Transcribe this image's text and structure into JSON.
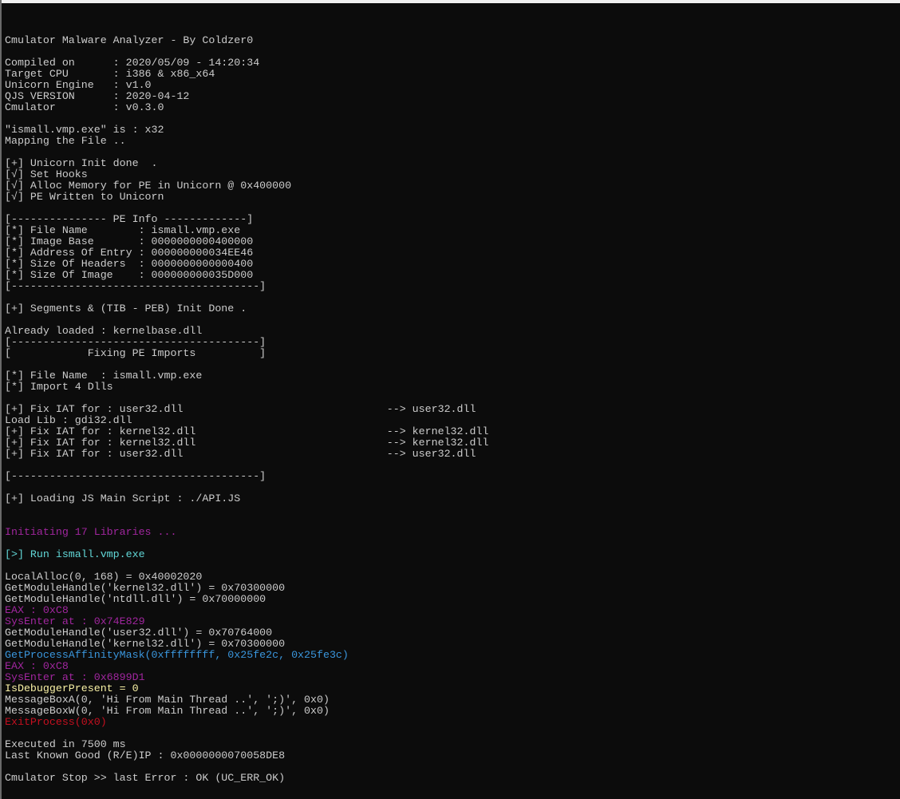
{
  "lines": [
    {
      "text": "",
      "color": "default"
    },
    {
      "text": "Cmulator Malware Analyzer - By Coldzer0",
      "color": "default"
    },
    {
      "text": "",
      "color": "default"
    },
    {
      "text": "Compiled on      : 2020/05/09 - 14:20:34",
      "color": "default"
    },
    {
      "text": "Target CPU       : i386 & x86_x64",
      "color": "default"
    },
    {
      "text": "Unicorn Engine   : v1.0",
      "color": "default"
    },
    {
      "text": "QJS VERSION      : 2020-04-12",
      "color": "default"
    },
    {
      "text": "Cmulator         : v0.3.0",
      "color": "default"
    },
    {
      "text": "",
      "color": "default"
    },
    {
      "text": "\"ismall.vmp.exe\" is : x32",
      "color": "default"
    },
    {
      "text": "Mapping the File ..",
      "color": "default"
    },
    {
      "text": "",
      "color": "default"
    },
    {
      "text": "[+] Unicorn Init done  .",
      "color": "default"
    },
    {
      "text": "[√] Set Hooks",
      "color": "default"
    },
    {
      "text": "[√] Alloc Memory for PE in Unicorn @ 0x400000",
      "color": "default"
    },
    {
      "text": "[√] PE Written to Unicorn",
      "color": "default"
    },
    {
      "text": "",
      "color": "default"
    },
    {
      "text": "[--------------- PE Info -------------]",
      "color": "default"
    },
    {
      "text": "[*] File Name        : ismall.vmp.exe",
      "color": "default"
    },
    {
      "text": "[*] Image Base       : 0000000000400000",
      "color": "default"
    },
    {
      "text": "[*] Address Of Entry : 000000000034EE46",
      "color": "default"
    },
    {
      "text": "[*] Size Of Headers  : 0000000000000400",
      "color": "default"
    },
    {
      "text": "[*] Size Of Image    : 000000000035D000",
      "color": "default"
    },
    {
      "text": "[---------------------------------------]",
      "color": "default"
    },
    {
      "text": "",
      "color": "default"
    },
    {
      "text": "[+] Segments & (TIB - PEB) Init Done .",
      "color": "default"
    },
    {
      "text": "",
      "color": "default"
    },
    {
      "text": "Already loaded : kernelbase.dll",
      "color": "default"
    },
    {
      "text": "[---------------------------------------]",
      "color": "default"
    },
    {
      "text": "[            Fixing PE Imports          ]",
      "color": "default"
    },
    {
      "text": "",
      "color": "default"
    },
    {
      "text": "[*] File Name  : ismall.vmp.exe",
      "color": "default"
    },
    {
      "text": "[*] Import 4 Dlls",
      "color": "default"
    },
    {
      "text": "",
      "color": "default"
    },
    {
      "text": "[+] Fix IAT for : user32.dll                                --> user32.dll",
      "color": "default"
    },
    {
      "text": "Load Lib : gdi32.dll",
      "color": "default"
    },
    {
      "text": "[+] Fix IAT for : kernel32.dll                              --> kernel32.dll",
      "color": "default"
    },
    {
      "text": "[+] Fix IAT for : kernel32.dll                              --> kernel32.dll",
      "color": "default"
    },
    {
      "text": "[+] Fix IAT for : user32.dll                                --> user32.dll",
      "color": "default"
    },
    {
      "text": "",
      "color": "default"
    },
    {
      "text": "[---------------------------------------]",
      "color": "default"
    },
    {
      "text": "",
      "color": "default"
    },
    {
      "text": "[+] Loading JS Main Script : ./API.JS",
      "color": "default"
    },
    {
      "text": "",
      "color": "default"
    },
    {
      "text": "",
      "color": "default"
    },
    {
      "text": "Initiating 17 Libraries ...",
      "color": "magenta"
    },
    {
      "text": "",
      "color": "default"
    },
    {
      "text": "[>] Run ismall.vmp.exe",
      "color": "cyan-light"
    },
    {
      "text": "",
      "color": "default"
    },
    {
      "text": "LocalAlloc(0, 168) = 0x40002020",
      "color": "default"
    },
    {
      "text": "GetModuleHandle('kernel32.dll') = 0x70300000",
      "color": "default"
    },
    {
      "text": "GetModuleHandle('ntdll.dll') = 0x70000000",
      "color": "default"
    },
    {
      "text": "EAX : 0xC8",
      "color": "magenta"
    },
    {
      "text": "SysEnter at : 0x74E829",
      "color": "magenta"
    },
    {
      "text": "GetModuleHandle('user32.dll') = 0x70764000",
      "color": "default"
    },
    {
      "text": "GetModuleHandle('kernel32.dll') = 0x70300000",
      "color": "default"
    },
    {
      "text": "GetProcessAffinityMask(0xffffffff, 0x25fe2c, 0x25fe3c)",
      "color": "cyan"
    },
    {
      "text": "EAX : 0xC8",
      "color": "magenta"
    },
    {
      "text": "SysEnter at : 0x6899D1",
      "color": "magenta"
    },
    {
      "text": "IsDebuggerPresent = 0",
      "color": "yellow"
    },
    {
      "text": "MessageBoxA(0, 'Hi From Main Thread ..', ';)', 0x0)",
      "color": "default"
    },
    {
      "text": "MessageBoxW(0, 'Hi From Main Thread ..', ';)', 0x0)",
      "color": "default"
    },
    {
      "text": "ExitProcess(0x0)",
      "color": "red"
    },
    {
      "text": "",
      "color": "default"
    },
    {
      "text": "Executed in 7500 ms",
      "color": "default"
    },
    {
      "text": "Last Known Good (R/E)IP : 0x0000000070058DE8",
      "color": "default"
    },
    {
      "text": "",
      "color": "default"
    },
    {
      "text": "Cmulator Stop >> last Error : OK (UC_ERR_OK)",
      "color": "default"
    }
  ],
  "colors": {
    "background": "#0c0c0c",
    "default": "#cccccc",
    "magenta": "#a0269e",
    "cyan": "#3a96dd",
    "cyan-light": "#61d6d6",
    "yellow": "#f9f1a5",
    "red": "#c50f1f"
  }
}
